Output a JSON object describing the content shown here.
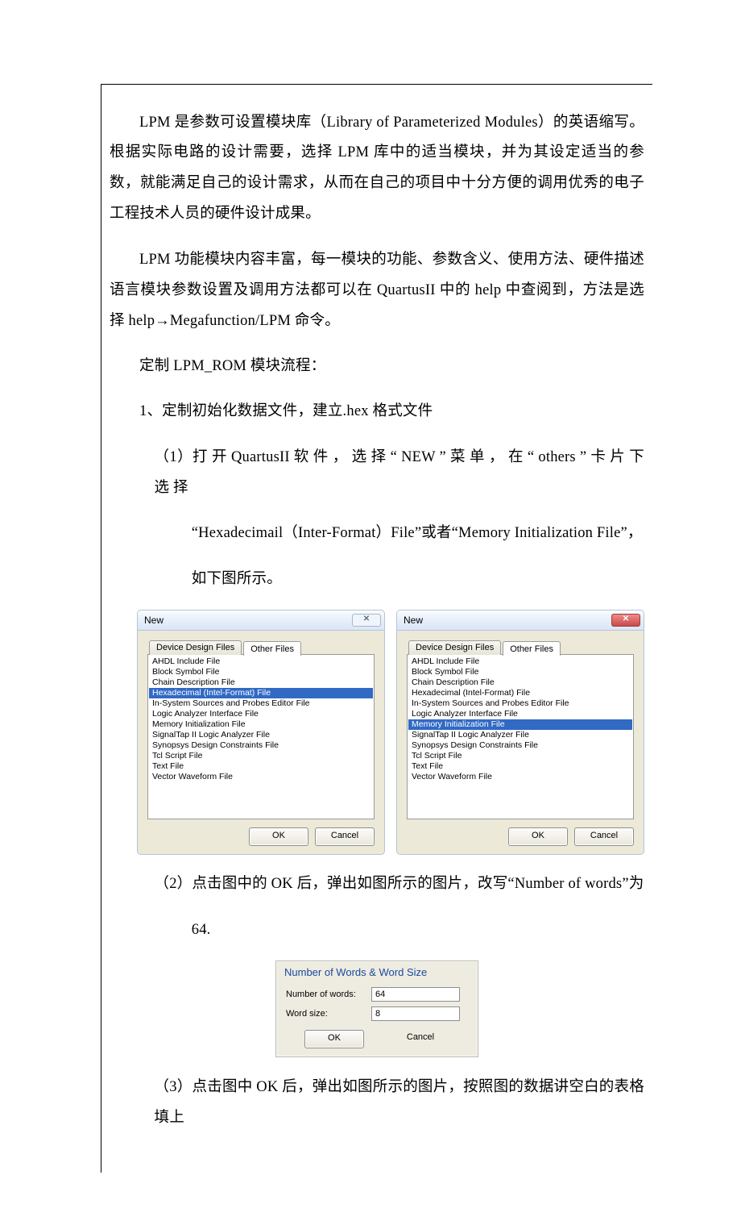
{
  "para1": "LPM 是参数可设置模块库（Library of Parameterized Modules）的英语缩写。根据实际电路的设计需要，选择 LPM 库中的适当模块，并为其设定适当的参数，就能满足自己的设计需求，从而在自己的项目中十分方便的调用优秀的电子工程技术人员的硬件设计成果。",
  "para2": "LPM 功能模块内容丰富，每一模块的功能、参数含义、使用方法、硬件描述语言模块参数设置及调用方法都可以在 QuartusII 中的 help 中查阅到，方法是选择 help→Megafunction/LPM 命令。",
  "heading": "定制 LPM_ROM 模块流程：",
  "step1": "1、定制初始化数据文件，建立.hex 格式文件",
  "step1_1_a": "（1）打 开 QuartusII 软 件 ， 选 择 “ NEW ” 菜 单 ， 在 “ others ” 卡 片 下 选 择",
  "step1_1_b": "“Hexadecimail（Inter-Format）File”或者“Memory Initialization File”，",
  "step1_1_c": "如下图所示。",
  "step1_2": "（2）点击图中的 OK 后，弹出如图所示的图片，改写“Number of words”为",
  "step1_2_val": "64.",
  "step1_3": "（3）点击图中 OK 后，弹出如图所示的图片，按照图的数据讲空白的表格填上",
  "dialog": {
    "title": "New",
    "tabs": {
      "inactive": "Device Design Files",
      "active": "Other Files"
    },
    "items": [
      "AHDL Include File",
      "Block Symbol File",
      "Chain Description File",
      "Hexadecimal (Intel-Format) File",
      "In-System Sources and Probes Editor File",
      "Logic Analyzer Interface File",
      "Memory Initialization File",
      "SignalTap II Logic Analyzer File",
      "Synopsys Design Constraints File",
      "Tcl Script File",
      "Text File",
      "Vector Waveform File"
    ],
    "selected_left": "Hexadecimal (Intel-Format) File",
    "selected_right": "Memory Initialization File",
    "ok": "OK",
    "cancel": "Cancel",
    "close": "✕"
  },
  "small": {
    "title": "Number of Words & Word Size",
    "label_words": "Number of words:",
    "value_words": "64",
    "label_size": "Word size:",
    "value_size": "8",
    "ok": "OK",
    "cancel": "Cancel"
  }
}
